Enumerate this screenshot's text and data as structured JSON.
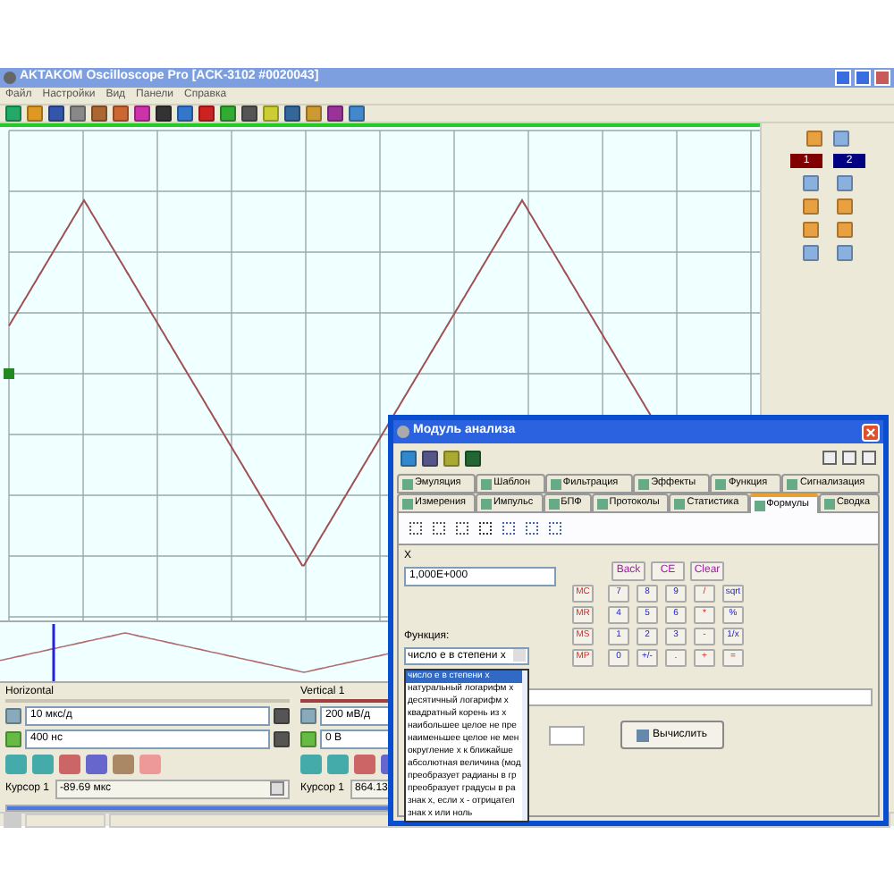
{
  "window": {
    "title": "AKTAKOM Oscilloscope Pro [ACK-3102 #0020043]"
  },
  "menu": [
    "Файл",
    "Настройки",
    "Вид",
    "Панели",
    "Справка"
  ],
  "channel_labels": [
    {
      "label": "1",
      "color": "#800000"
    },
    {
      "label": "2",
      "color": "#000080"
    }
  ],
  "horizontal": {
    "title": "Horizontal",
    "scale": "10 мкс/д",
    "offset": "400 нс",
    "cursor_label": "Курсор 1",
    "cursor_value": "-89.69 мкс"
  },
  "vertical": {
    "title": "Vertical 1",
    "scale": "200 мВ/д",
    "offset": "0 В",
    "cursor_label": "Курсор 1",
    "cursor_value": "864.13"
  },
  "dialog": {
    "title": "Модуль анализа",
    "tabs_row1": [
      {
        "label": "Эмуляция",
        "selected": false
      },
      {
        "label": "Шаблон",
        "selected": false
      },
      {
        "label": "Фильтрация",
        "selected": false
      },
      {
        "label": "Эффекты",
        "selected": false
      },
      {
        "label": "Функция",
        "selected": false
      },
      {
        "label": "Сигнализация",
        "selected": false
      }
    ],
    "tabs_row2": [
      {
        "label": "Измерения",
        "selected": false
      },
      {
        "label": "Импульс",
        "selected": false
      },
      {
        "label": "БПФ",
        "selected": false
      },
      {
        "label": "Протоколы",
        "selected": false
      },
      {
        "label": "Статистика",
        "selected": false
      },
      {
        "label": "Формулы",
        "selected": true
      },
      {
        "label": "Сводка",
        "selected": false
      }
    ],
    "x_label": "X",
    "x_value": "1,000E+000",
    "edit_keys": [
      "Back",
      "CE",
      "Clear"
    ],
    "keys": [
      [
        {
          "label": "MC",
          "kind": "memory"
        },
        {
          "label": "7",
          "kind": "digit"
        },
        {
          "label": "8",
          "kind": "digit"
        },
        {
          "label": "9",
          "kind": "digit"
        },
        {
          "label": "/",
          "kind": "op"
        },
        {
          "label": "sqrt",
          "kind": "func"
        }
      ],
      [
        {
          "label": "MR",
          "kind": "memory"
        },
        {
          "label": "4",
          "kind": "digit"
        },
        {
          "label": "5",
          "kind": "digit"
        },
        {
          "label": "6",
          "kind": "digit"
        },
        {
          "label": "*",
          "kind": "op"
        },
        {
          "label": "%",
          "kind": "func"
        }
      ],
      [
        {
          "label": "MS",
          "kind": "memory"
        },
        {
          "label": "1",
          "kind": "digit"
        },
        {
          "label": "2",
          "kind": "digit"
        },
        {
          "label": "3",
          "kind": "digit"
        },
        {
          "label": "-",
          "kind": "op"
        },
        {
          "label": "1/x",
          "kind": "func"
        }
      ],
      [
        {
          "label": "MP",
          "kind": "memory"
        },
        {
          "label": "0",
          "kind": "digit"
        },
        {
          "label": "+/-",
          "kind": "digit"
        },
        {
          "label": ".",
          "kind": "digit"
        },
        {
          "label": "+",
          "kind": "op"
        },
        {
          "label": "=",
          "kind": "op"
        }
      ]
    ],
    "function_label": "Функция:",
    "function_value": "число e в степени x",
    "function_options": [
      {
        "label": "число e в степени x",
        "selected": true
      },
      {
        "label": "натуральный логарифм x",
        "selected": false
      },
      {
        "label": "десятичный логарифм x",
        "selected": false
      },
      {
        "label": "квадратный корень из x",
        "selected": false
      },
      {
        "label": "наибольшее целое не пре",
        "selected": false
      },
      {
        "label": "наименьшее целое не мен",
        "selected": false
      },
      {
        "label": "округление x к ближайше",
        "selected": false
      },
      {
        "label": "абсолютная величина (мод",
        "selected": false
      },
      {
        "label": "преобразует радианы в гр",
        "selected": false
      },
      {
        "label": "преобразует градусы в ра",
        "selected": false
      },
      {
        "label": "знак x, если x - отрицател",
        "selected": false
      },
      {
        "label": "знак x или ноль",
        "selected": false
      }
    ],
    "compute_button": "Вычислить"
  }
}
